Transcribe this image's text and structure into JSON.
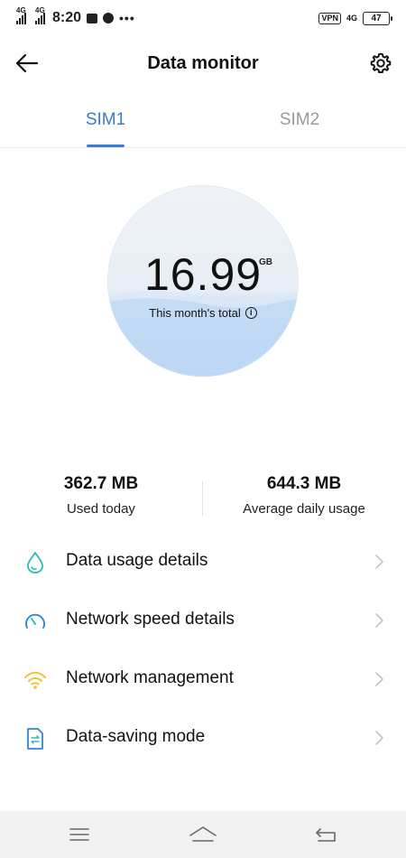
{
  "status_bar": {
    "network_1": "4G",
    "network_2": "4G",
    "time": "8:20",
    "more": "•••",
    "vpn": "VPN",
    "network_right": "4G",
    "battery": "47",
    "icons": [
      "signal-icon",
      "signal-icon",
      "email-icon",
      "message-icon",
      "more-icon",
      "vpn-icon",
      "mobile-data-icon",
      "battery-icon"
    ]
  },
  "header": {
    "title": "Data monitor",
    "back_icon": "arrow-left-icon",
    "settings_icon": "gear-icon"
  },
  "tabs": [
    {
      "label": "SIM1",
      "active": true
    },
    {
      "label": "SIM2",
      "active": false
    }
  ],
  "gauge": {
    "value": "16.99",
    "unit": "GB",
    "caption": "This month's total",
    "info_glyph": "i",
    "fill_fraction": 0.55
  },
  "stats": {
    "today": {
      "value": "362.7 MB",
      "label": "Used today"
    },
    "average": {
      "value": "644.3 MB",
      "label": "Average daily usage"
    }
  },
  "menu": [
    {
      "label": "Data usage details",
      "icon": "droplet-icon"
    },
    {
      "label": "Network speed details",
      "icon": "speedometer-icon"
    },
    {
      "label": "Network management",
      "icon": "wifi-icon"
    },
    {
      "label": "Data-saving mode",
      "icon": "data-saving-file-icon"
    }
  ],
  "nav": {
    "icons": [
      "menu-icon",
      "home-icon",
      "back-icon"
    ]
  },
  "colors": {
    "accent": "#3a7bd5",
    "teal_icon": "#2bbdb0",
    "blue_icon": "#2f86d6",
    "wifi_icon": "#f2c230",
    "nav_background": "#f1f1f1"
  }
}
